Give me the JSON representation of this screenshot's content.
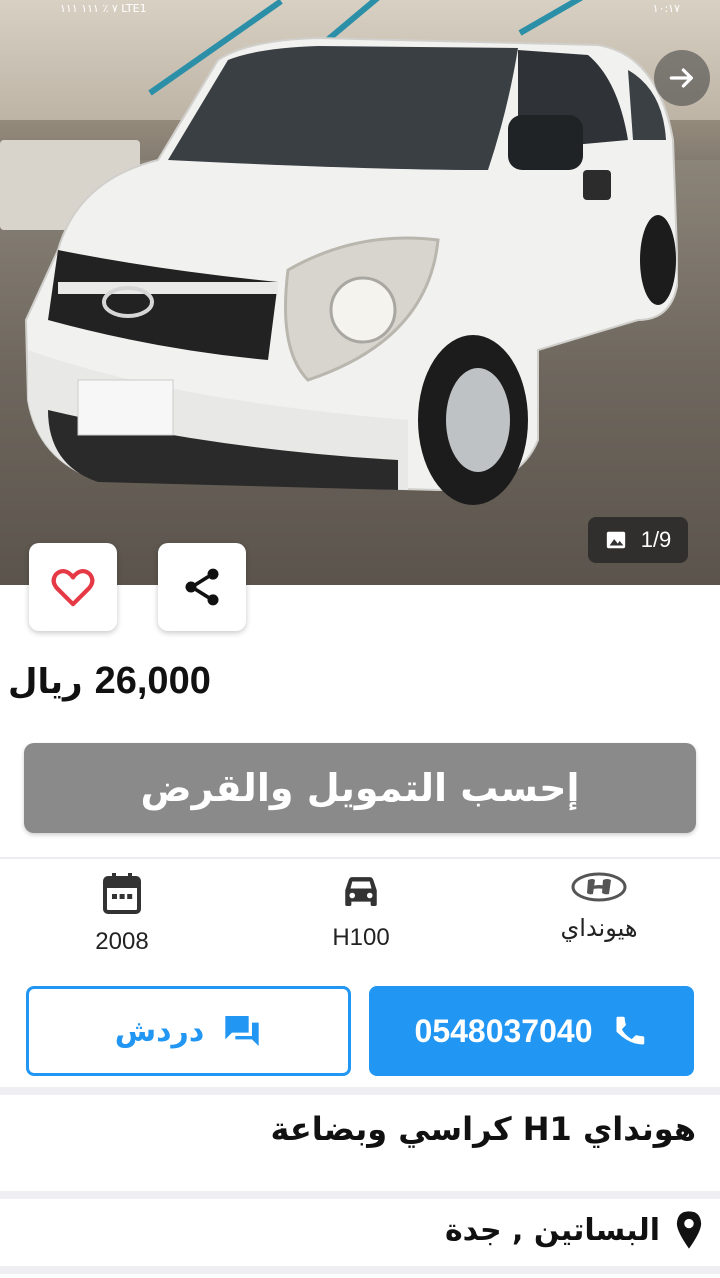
{
  "status_bar": {
    "left": "٧ ٪ ١١١ ١١١ LTE1",
    "right": "١٠:١٧"
  },
  "gallery": {
    "counter": "1/9"
  },
  "listing": {
    "price_amount": "26,000",
    "currency": "ريال",
    "finance_button": "إحسب التمويل والقرض",
    "title": "هونداي H1 كراسي وبضاعة",
    "location": "البساتين , جدة"
  },
  "specs": {
    "year": "2008",
    "model": "H100",
    "make": "هيونداي"
  },
  "contact": {
    "phone": "0548037040",
    "chat_label": "دردش"
  },
  "colors": {
    "primary": "#2196f3",
    "favorite": "#e53946",
    "finance_bg": "#8a8a8a"
  },
  "icons": [
    "arrow-right-icon",
    "image-icon",
    "heart-icon",
    "share-icon",
    "calendar-icon",
    "car-icon",
    "hyundai-logo-icon",
    "chat-icon",
    "phone-icon",
    "location-pin-icon"
  ]
}
